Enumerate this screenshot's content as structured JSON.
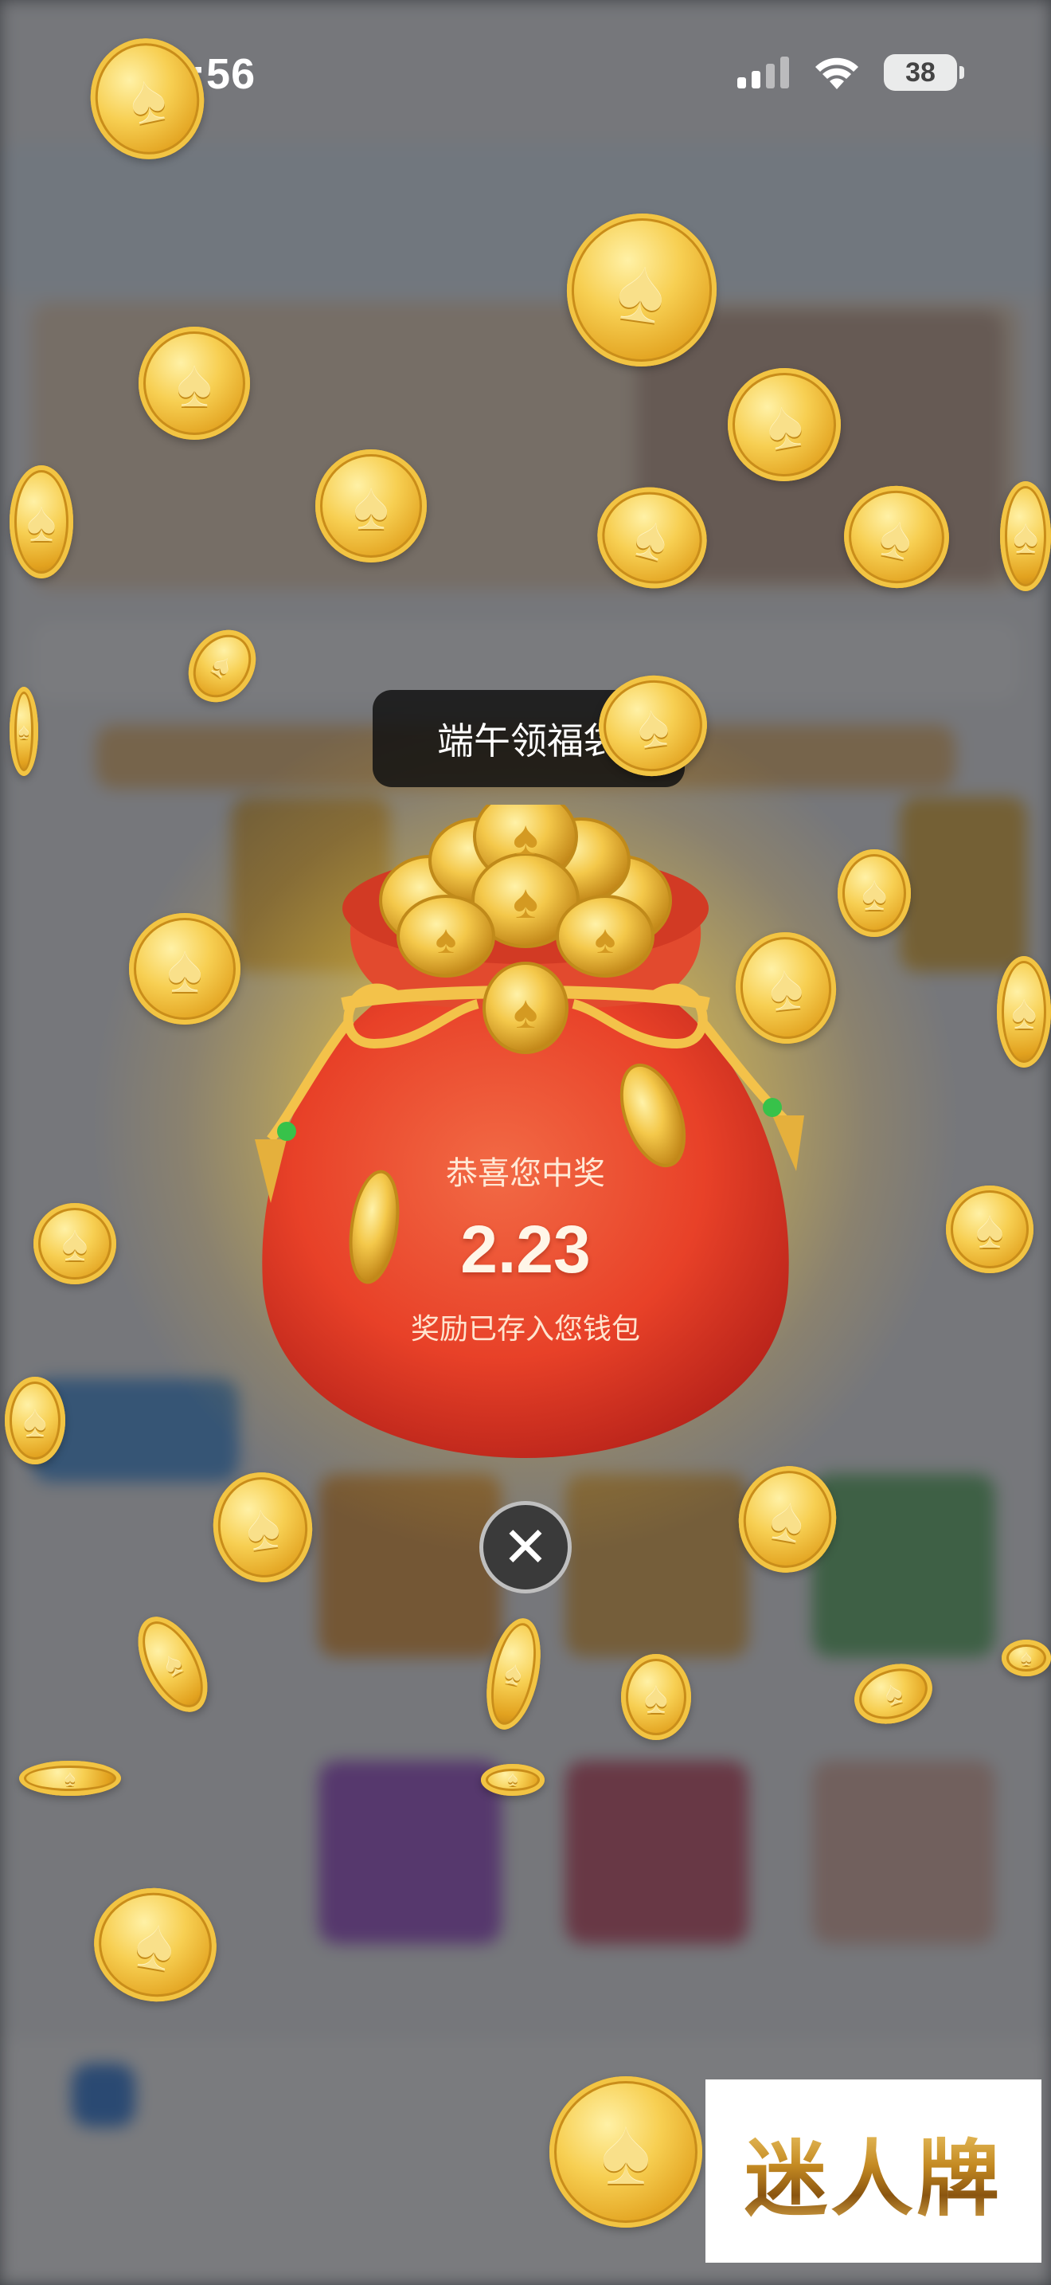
{
  "status_bar": {
    "time": "02:56",
    "battery": "38"
  },
  "event": {
    "title": "端午领福袋"
  },
  "reward": {
    "congrats": "恭喜您中奖",
    "amount": "2.23",
    "note": "奖励已存入您钱包"
  },
  "close": {
    "glyph": "✕"
  },
  "watermark": {
    "text": "迷人牌"
  },
  "colors": {
    "bag_red": "#e8432a",
    "gold": "#f2c443",
    "overlay": "#2a2c30"
  }
}
